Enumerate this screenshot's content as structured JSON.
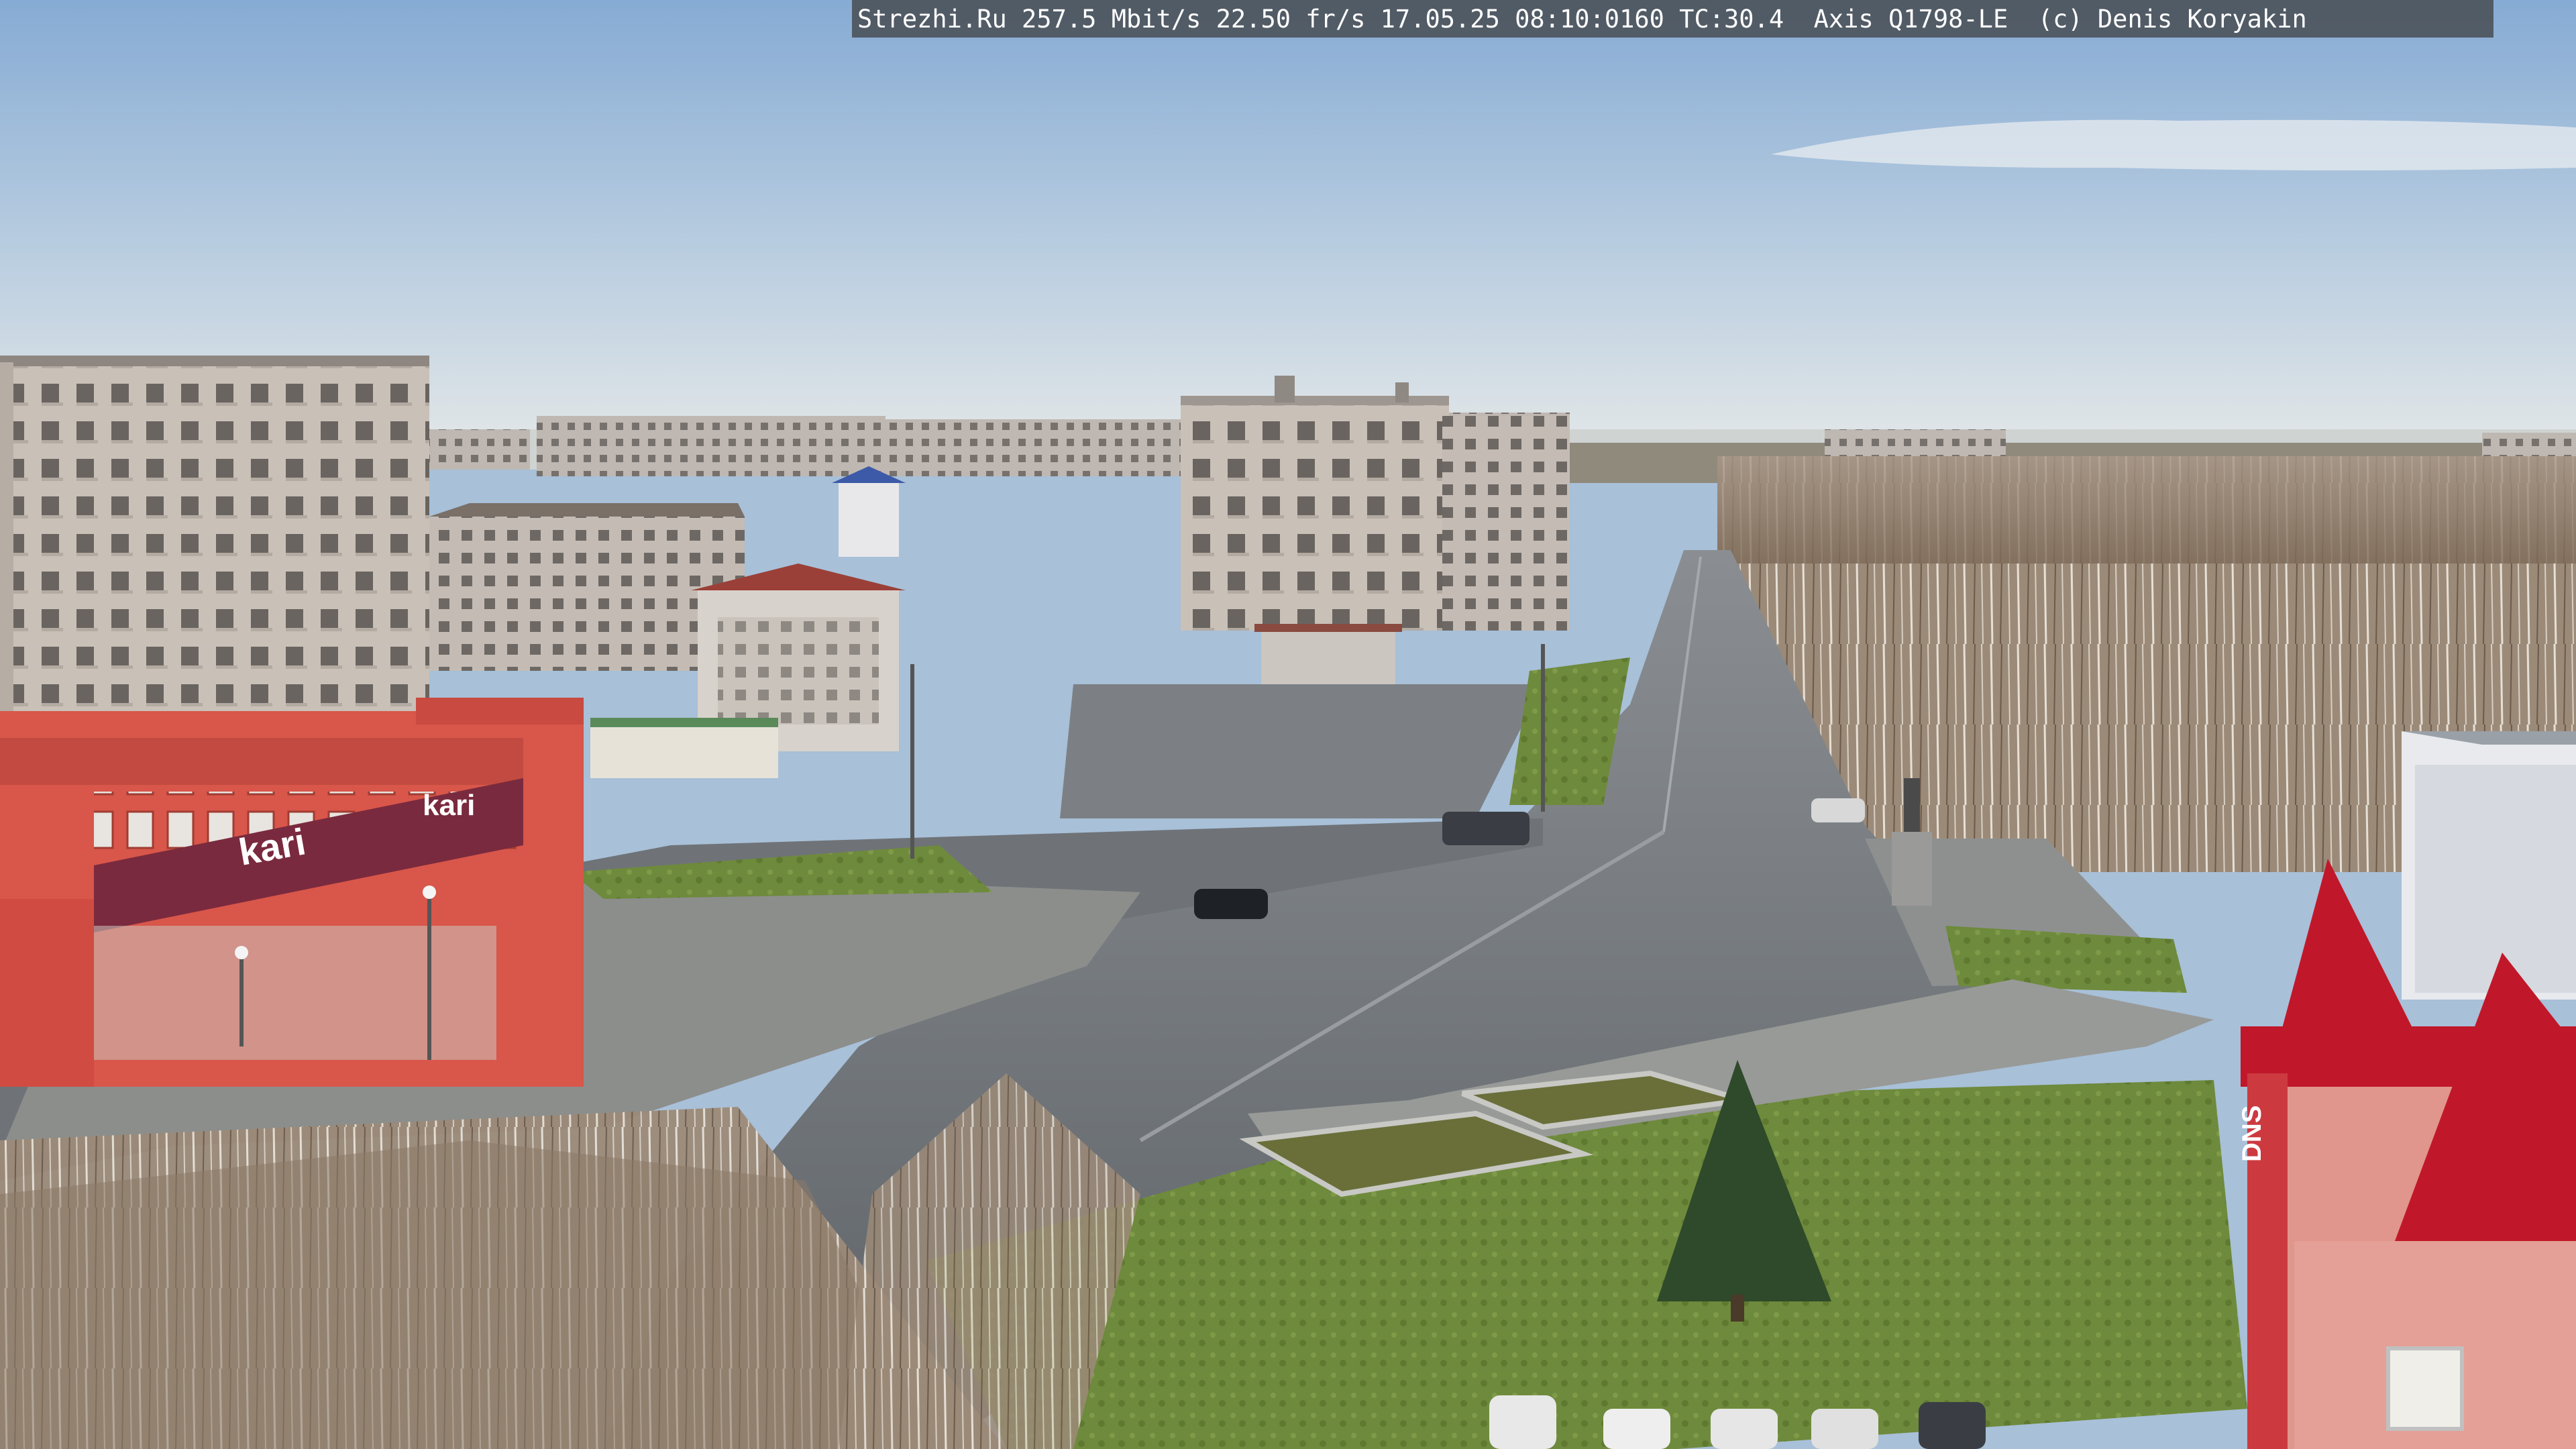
{
  "camera_overlay": {
    "text": "Strezhi.Ru 257.5 Mbit/s 22.50 fr/s 17.05.25 08:10:0160 TC:30.4  Axis Q1798-LE  (c) Denis Koryakin"
  },
  "signs": {
    "store_brand": "kari",
    "store_brand_2": "kari",
    "tower_brand": "DNS"
  },
  "colors": {
    "sky_top": "#8fb3d9",
    "sky_bottom": "#dfe6ea",
    "store_facade": "#d8564a",
    "store_band": "#7a2a3e",
    "tower_roof": "#c0182a",
    "road": "#6d7176",
    "grass": "#6f8a3a",
    "trees": "#9a8670"
  }
}
